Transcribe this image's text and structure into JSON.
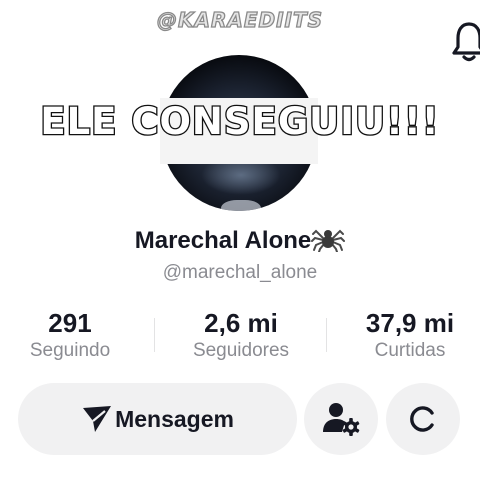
{
  "watermark": "@KARAEDIITS",
  "banner": "ELE CONSEGUIU!!!",
  "profile": {
    "name": "Marechal Alone",
    "name_emoji_icon": "spider-icon",
    "handle": "@marechal_alone"
  },
  "stats": [
    {
      "value": "291",
      "label": "Seguindo"
    },
    {
      "value": "2,6 mi",
      "label": "Seguidores"
    },
    {
      "value": "37,9 mi",
      "label": "Curtidas"
    }
  ],
  "actions": {
    "message_label": "Mensagem",
    "message_icon": "send-icon",
    "account_settings_icon": "user-gear-icon",
    "refresh_icon": "refresh-icon"
  },
  "header": {
    "notifications_icon": "bell-icon"
  },
  "colors": {
    "text_primary": "#161823",
    "text_secondary": "#8a8b91",
    "button_bg": "#f1f1f2"
  }
}
